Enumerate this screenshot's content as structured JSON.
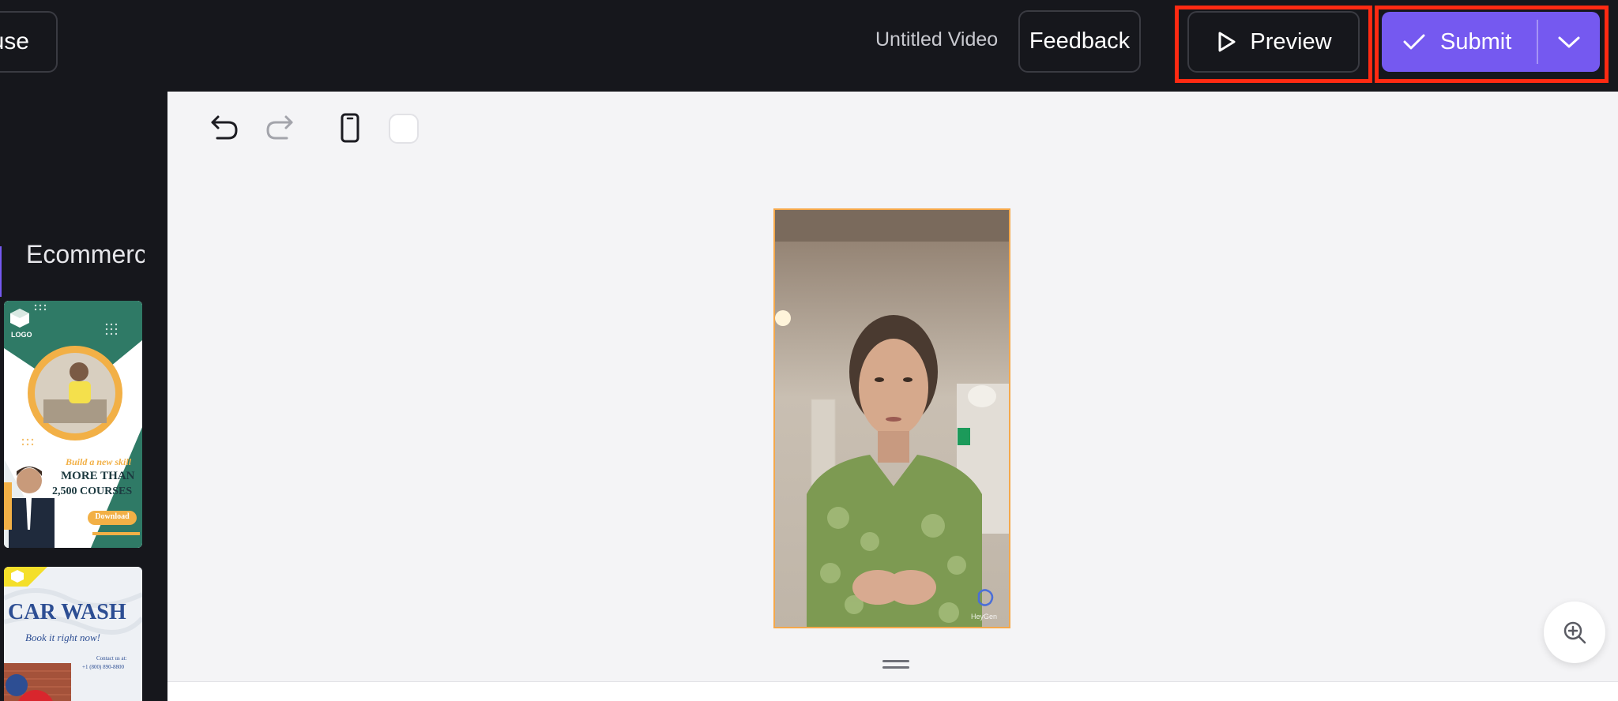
{
  "header": {
    "pause_label": "use",
    "title": "Untitled Video",
    "feedback_label": "Feedback",
    "preview_label": "Preview",
    "submit_label": "Submit"
  },
  "sidebar": {
    "active_tab": "Ecommerce",
    "templates": [
      {
        "logo": "LOGO",
        "tagline": "Build a new skill",
        "headline_1": "MORE THAN",
        "headline_2": "2,500 COURSES",
        "cta": "Download"
      },
      {
        "headline": "CAR WASH",
        "subtitle": "Book it right now!",
        "contact": "Contact us at:",
        "phone": "+1 (800) 890-8800"
      }
    ]
  },
  "canvas": {
    "watermark": "HeyGen"
  },
  "colors": {
    "topbar_bg": "#16171c",
    "accent": "#7559f0",
    "highlight": "#ff2a12",
    "selection": "#f5a84a",
    "canvas_bg": "#f4f4f6"
  },
  "icons": {
    "undo": "undo-icon",
    "redo": "redo-icon",
    "device": "phone-icon",
    "background": "background-color-icon",
    "play": "play-icon",
    "check": "check-icon",
    "caret": "chevron-down-icon",
    "collapse": "chevron-left-icon",
    "zoom": "zoom-in-icon"
  }
}
